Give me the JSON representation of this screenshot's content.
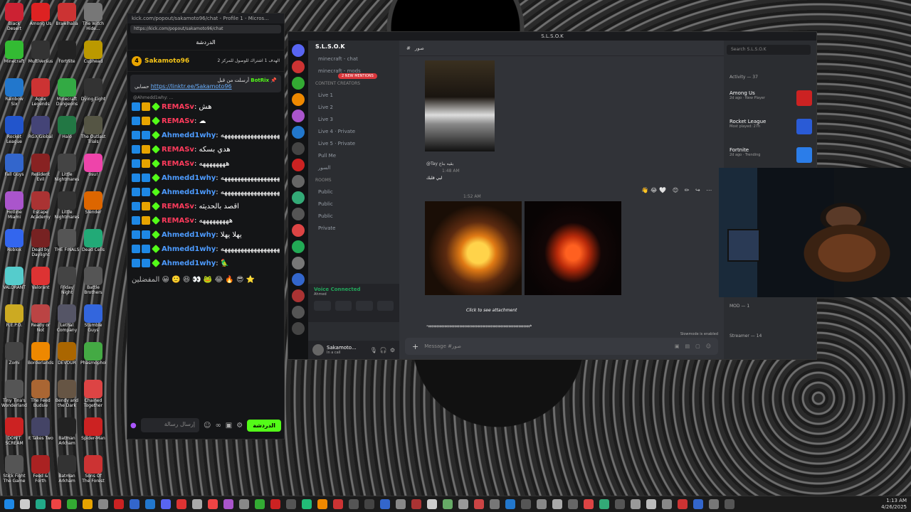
{
  "desktop": {
    "icons": [
      {
        "label": "Black Desert",
        "color": "#c23"
      },
      {
        "label": "Among Us",
        "color": "#d22"
      },
      {
        "label": "Brawlhalla",
        "color": "#c33"
      },
      {
        "label": "The Witch Hide...",
        "color": "#777"
      },
      {
        "label": "Minecraft",
        "color": "#3b3"
      },
      {
        "label": "MultiVersus",
        "color": "#333"
      },
      {
        "label": "Fortnite",
        "color": "#222"
      },
      {
        "label": "Cuphead",
        "color": "#b90"
      },
      {
        "label": "Rainbow Six",
        "color": "#27c"
      },
      {
        "label": "Apex Legends",
        "color": "#c33"
      },
      {
        "label": "Minecraft Dungeons",
        "color": "#3a4"
      },
      {
        "label": "Dying Light",
        "color": "#333"
      },
      {
        "label": "Rocket League",
        "color": "#25c"
      },
      {
        "label": "RGX Global",
        "color": "#447"
      },
      {
        "label": "Halo",
        "color": "#274"
      },
      {
        "label": "The Outlast Trials",
        "color": "#554"
      },
      {
        "label": "Fall Guys",
        "color": "#36c"
      },
      {
        "label": "Resident Evil",
        "color": "#822"
      },
      {
        "label": "Little Nightmares",
        "color": "#444"
      },
      {
        "label": "osu!",
        "color": "#e4a"
      },
      {
        "label": "Hotline Miami",
        "color": "#a5c"
      },
      {
        "label": "Escape Academy",
        "color": "#a33"
      },
      {
        "label": "Little Nightmares II",
        "color": "#333"
      },
      {
        "label": "Slender",
        "color": "#d60"
      },
      {
        "label": "Roblox",
        "color": "#36e"
      },
      {
        "label": "Dead by Daylight",
        "color": "#722"
      },
      {
        "label": "THE FINALS",
        "color": "#555"
      },
      {
        "label": "Dead Cells",
        "color": "#2a7"
      },
      {
        "label": "VALORANT",
        "color": "#5cc"
      },
      {
        "label": "Valorant",
        "color": "#d33"
      },
      {
        "label": "Friday Night",
        "color": "#444"
      },
      {
        "label": "Battle Brothers",
        "color": "#555"
      },
      {
        "label": "R.E.P.O.",
        "color": "#ca2"
      },
      {
        "label": "Ready or Not",
        "color": "#b44"
      },
      {
        "label": "Lethal Company",
        "color": "#556"
      },
      {
        "label": "Stumble Guys",
        "color": "#36d"
      },
      {
        "label": "Zomi",
        "color": "#444"
      },
      {
        "label": "Borderlands",
        "color": "#e80"
      },
      {
        "label": "DEVOUR",
        "color": "#a60"
      },
      {
        "label": "Phasmophobia",
        "color": "#4a4"
      },
      {
        "label": "Tiny Tina's Wonderlands",
        "color": "#555"
      },
      {
        "label": "The Feed Budsie",
        "color": "#a63"
      },
      {
        "label": "Bendy and the Dark",
        "color": "#654"
      },
      {
        "label": "Chained Together",
        "color": "#d44"
      },
      {
        "label": "DON'T SCREAM",
        "color": "#c22"
      },
      {
        "label": "It Takes Two",
        "color": "#446"
      },
      {
        "label": "Batman Arkham",
        "color": "#222"
      },
      {
        "label": "Spider-Man",
        "color": "#c22"
      },
      {
        "label": "Stick Fight The Game",
        "color": "#555"
      },
      {
        "label": "Feed & Forth",
        "color": "#a22"
      },
      {
        "label": "Batman Arkham Asy...",
        "color": "#333"
      },
      {
        "label": "Sons Of The Forest",
        "color": "#c33"
      }
    ]
  },
  "kick": {
    "window_title": "kick.com/popout/sakamoto96/chat - Profile 1 - Micros...",
    "url": "https://kick.com/popout/sakamoto96/chat",
    "chat_header": "الدردشة",
    "channel_name": "Sakamoto96",
    "channel_level": "4",
    "channel_note": "الهدف 1 اشتراك للوصول للمركز 2",
    "pinned": {
      "author": "BotRix",
      "label": "أرسلت من قبل",
      "prefix": "حسابي",
      "link": "https://linktr.ee/Sakamoto96"
    },
    "reply_preview": "@Ahmedd1why: ...",
    "messages": [
      {
        "user": "REMASv",
        "style": "u1",
        "badge": "b-crown",
        "text": "هش"
      },
      {
        "user": "REMASv",
        "style": "u1",
        "badge": "b-crown",
        "text": "☁"
      },
      {
        "user": "Ahmedd1why",
        "style": "u2",
        "badge": "b-blue",
        "text": "ههههههههههههههههههههههههههههههههه"
      },
      {
        "user": "REMASv",
        "style": "u1",
        "badge": "b-crown",
        "text": "هدي بسكه"
      },
      {
        "user": "REMASv",
        "style": "u1",
        "badge": "b-crown",
        "text": "ههههههههه"
      },
      {
        "user": "Ahmedd1why",
        "style": "u2",
        "badge": "b-blue",
        "text": "ههههههههههههههههههههههههههههههههه"
      },
      {
        "user": "Ahmedd1why",
        "style": "u2",
        "badge": "b-blue",
        "text": "ههههههههههههههههههههههههههههههههه"
      },
      {
        "user": "REMASv",
        "style": "u1",
        "badge": "b-crown",
        "text": "اقصد بالحديثه"
      },
      {
        "user": "REMASv",
        "style": "u1",
        "badge": "b-crown",
        "text": "هههههههههه"
      },
      {
        "user": "Ahmedd1why",
        "style": "u2",
        "badge": "b-blue",
        "text": "يهلا يهلا"
      },
      {
        "user": "Ahmedd1why",
        "style": "u2",
        "badge": "b-blue",
        "text": "ههههههههههههههههههههههههههههههههه"
      },
      {
        "user": "Ahmedd1why",
        "style": "u2",
        "badge": "b-blue",
        "text": "🦜"
      }
    ],
    "emote_row_label": "المفضلين",
    "input_placeholder": "إرسال رسالة",
    "send_label": "الدردشة"
  },
  "discord": {
    "window_title": "S.L.S.O.K",
    "server_name": "S.L.S.O.K",
    "new_mentions": "2 NEW MENTIONS",
    "channels": [
      {
        "label": "minecraft - chat",
        "cat": false
      },
      {
        "label": "minecraft - mods",
        "cat": false
      },
      {
        "label": "CONTENT CREATORS",
        "cat": true
      },
      {
        "label": "Live 1",
        "cat": false
      },
      {
        "label": "Live 2",
        "cat": false
      },
      {
        "label": "Live 3",
        "cat": false
      },
      {
        "label": "Live 4 · Private",
        "cat": false
      },
      {
        "label": "Live 5 · Private",
        "cat": false
      },
      {
        "label": "Pull Me",
        "cat": false
      },
      {
        "label": "السور",
        "cat": false
      },
      {
        "label": "ROOMS",
        "cat": true
      },
      {
        "label": "Public",
        "cat": false
      },
      {
        "label": "Public",
        "cat": false
      },
      {
        "label": "Public",
        "cat": false
      },
      {
        "label": "Private",
        "cat": false
      }
    ],
    "voice_status": "Voice Connected",
    "voice_sub": "Ahmed",
    "username": "Sakamoto...",
    "user_status": "In a call",
    "channel_header": "صور",
    "msg1_reply": "@Tay بقيه بناغ",
    "msg1_text": "لبي قلبك",
    "msg1_time": "1:48 AM",
    "msg2_time": "1:52 AM",
    "reactions": "👋😂🤍 😊 ✏ ↪ ⋯",
    "attachment_hint": "Click to see attachment",
    "long_msg": "هههههههههههههههههههههههههههههههههههههههههههههههههههههههههههههههه",
    "slowmode": "Slowmode is enabled",
    "message_placeholder": "Message #صور",
    "search_placeholder": "Search S.L.S.O.K",
    "activity_header": "Activity — 37",
    "activities": [
      {
        "name": "Among Us",
        "sub": "2d ago · New Player",
        "color": "#c22"
      },
      {
        "name": "Rocket League",
        "sub": "Most played: 27h",
        "color": "#2a5bd6"
      },
      {
        "name": "Fortnite",
        "sub": "2d ago · Trending",
        "color": "#2b7de9"
      }
    ],
    "mod_group": "MOD — 1",
    "streamer_group": "Streamer — 14"
  },
  "taskbar": {
    "time": "1:13 AM",
    "date": "4/26/2025"
  }
}
